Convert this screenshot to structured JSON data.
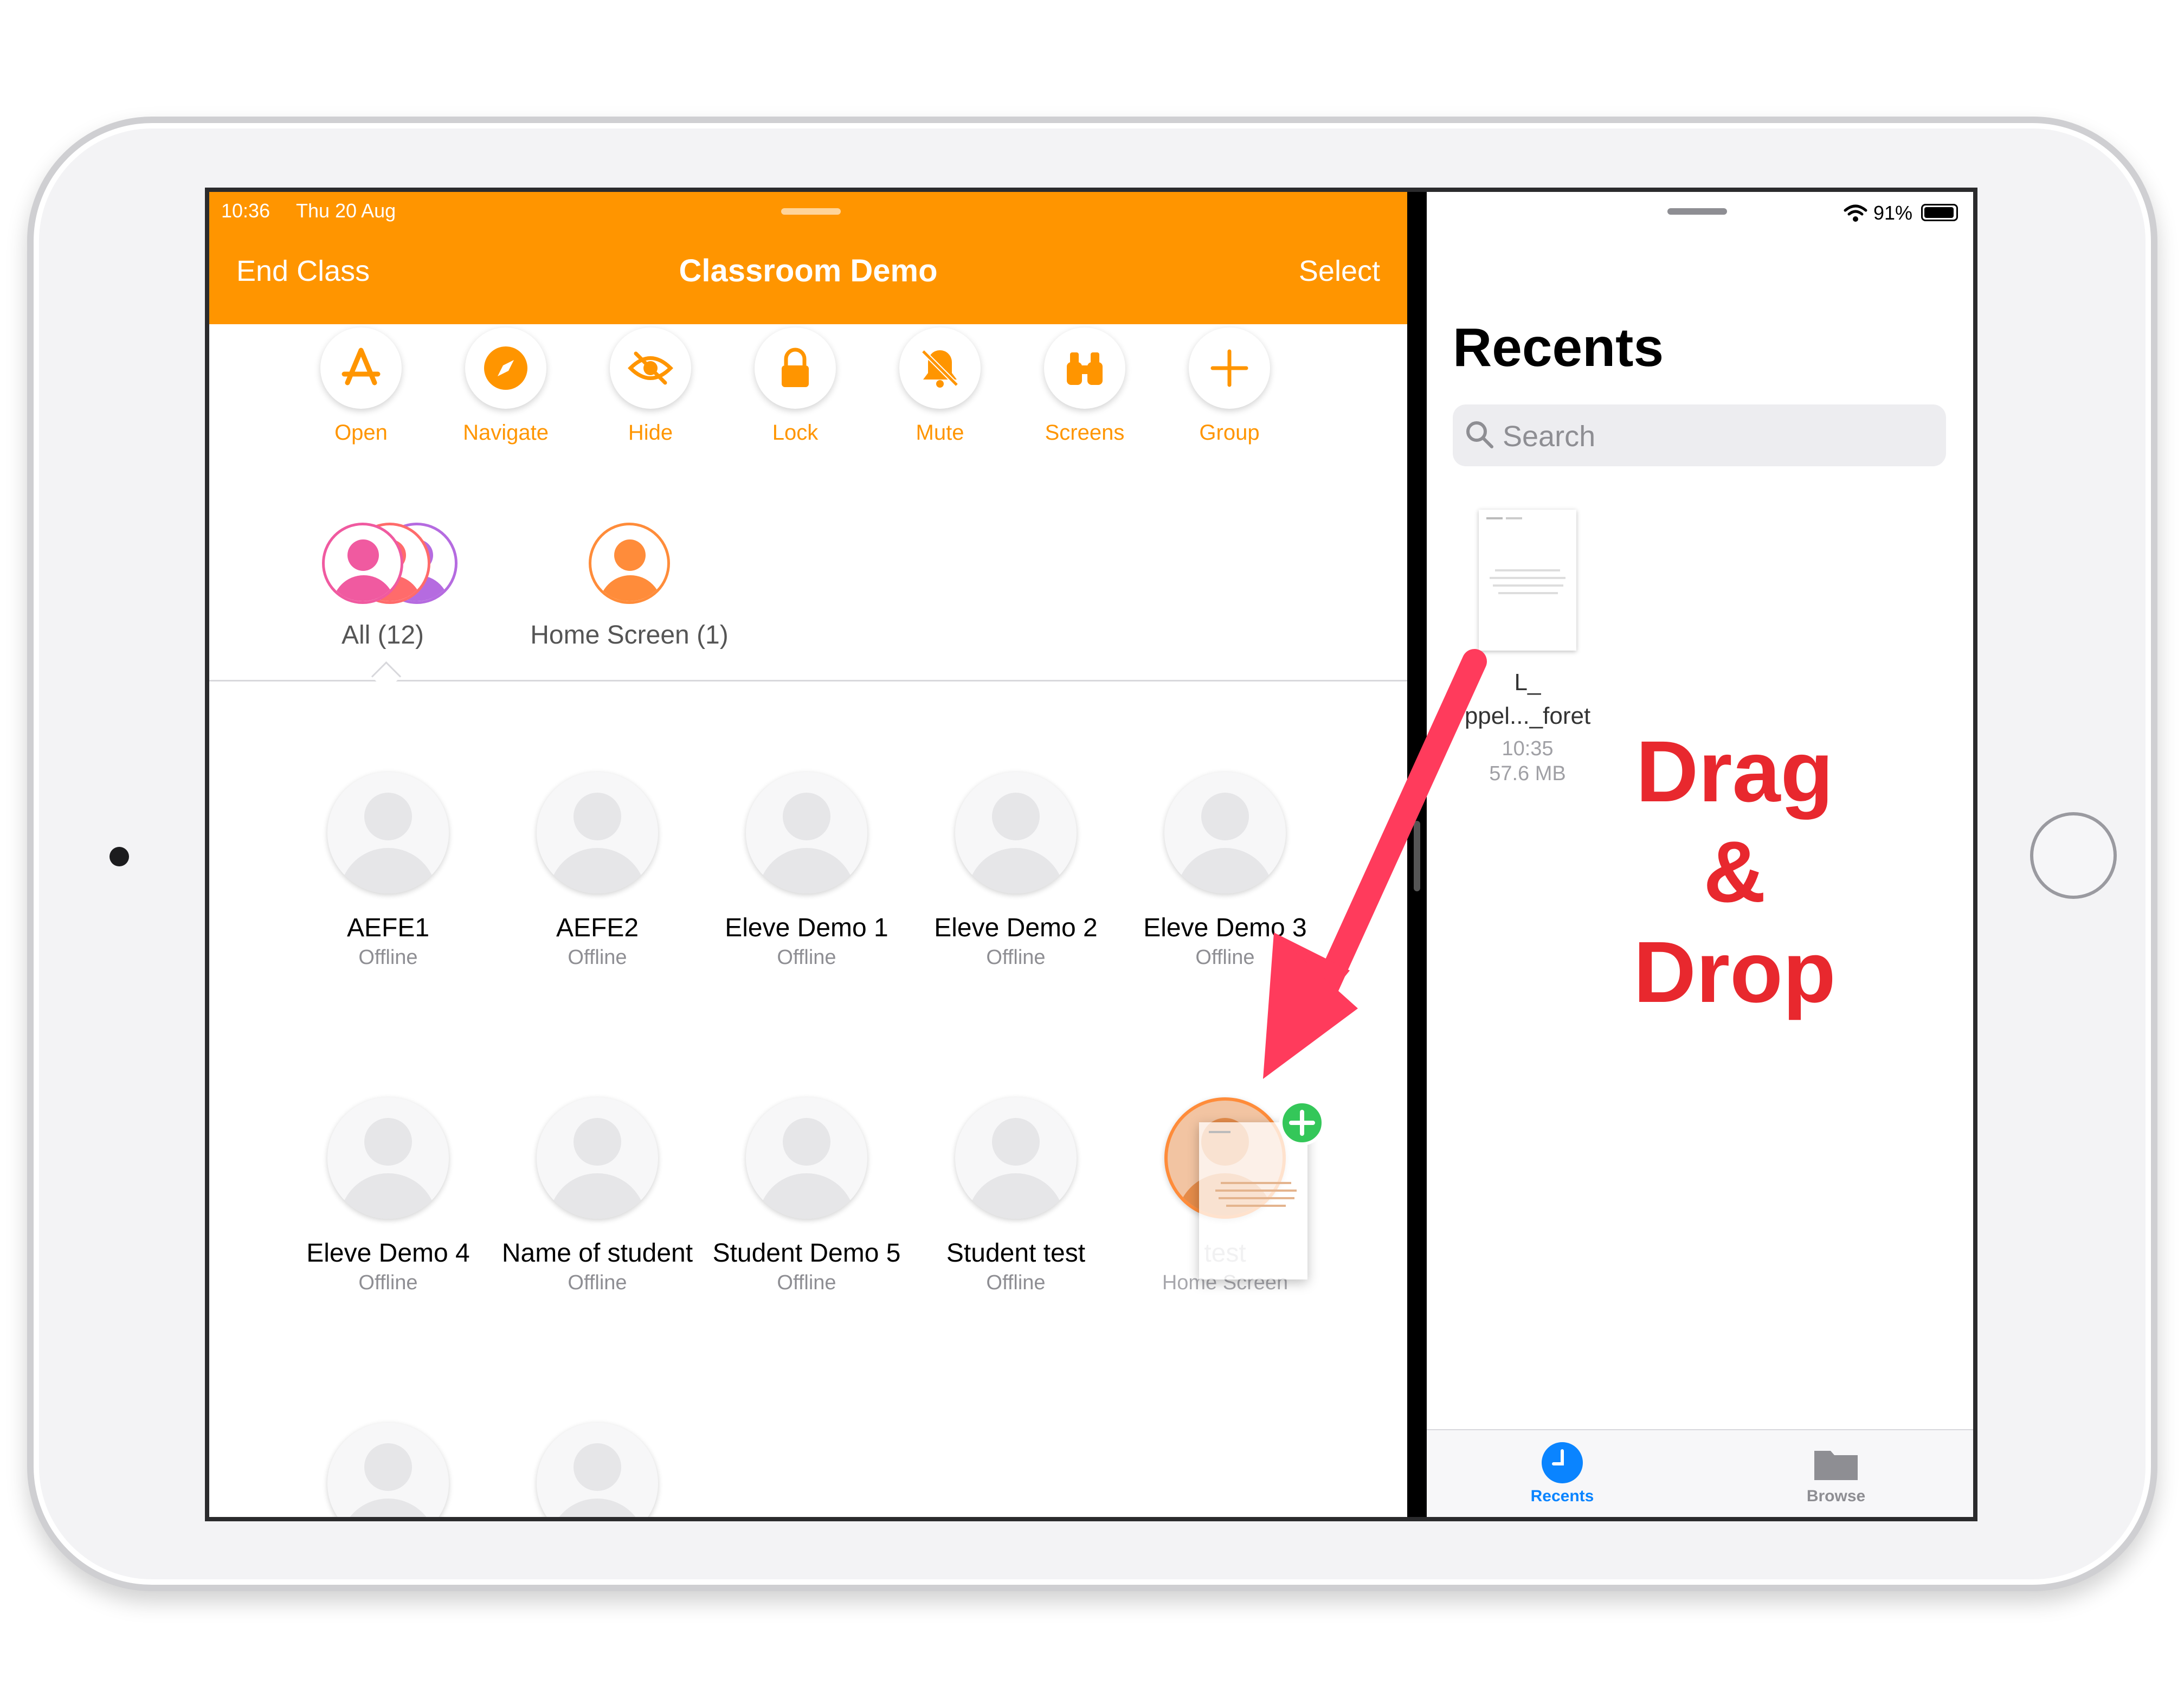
{
  "status_bar": {
    "time": "10:36",
    "date": "Thu 20 Aug",
    "battery": "91%"
  },
  "nav": {
    "left_button": "End Class",
    "title": "Classroom Demo",
    "right_button": "Select"
  },
  "actions": [
    {
      "label": "Open",
      "icon": "app-store-icon"
    },
    {
      "label": "Navigate",
      "icon": "compass-icon"
    },
    {
      "label": "Hide",
      "icon": "eye-slash-icon"
    },
    {
      "label": "Lock",
      "icon": "lock-icon"
    },
    {
      "label": "Mute",
      "icon": "bell-slash-icon"
    },
    {
      "label": "Screens",
      "icon": "binoculars-icon"
    },
    {
      "label": "Group",
      "icon": "plus-icon"
    }
  ],
  "groups": [
    {
      "label": "All (12)",
      "selected": true
    },
    {
      "label": "Home Screen (1)",
      "selected": false
    }
  ],
  "students": [
    {
      "name": "AEFE1",
      "status": "Offline"
    },
    {
      "name": "AEFE2",
      "status": "Offline"
    },
    {
      "name": "Eleve Demo 1",
      "status": "Offline"
    },
    {
      "name": "Eleve Demo 2",
      "status": "Offline"
    },
    {
      "name": "Eleve Demo 3",
      "status": "Offline"
    },
    {
      "name": "Eleve Demo 4",
      "status": "Offline"
    },
    {
      "name": "Name of student",
      "status": "Offline"
    },
    {
      "name": "Student Demo 5",
      "status": "Offline"
    },
    {
      "name": "Student test",
      "status": "Offline"
    },
    {
      "name": "test",
      "status": "Home Screen"
    }
  ],
  "files_app": {
    "title": "Recents",
    "search_placeholder": "Search",
    "file": {
      "name_line1": "L_",
      "name_line2": "ppel..._foret",
      "time": "10:35",
      "size": "57.6 MB"
    },
    "tabs": [
      {
        "label": "Recents",
        "active": true
      },
      {
        "label": "Browse",
        "active": false
      }
    ]
  },
  "annotation": {
    "line1": "Drag",
    "line2": "&",
    "line3": "Drop"
  },
  "colors": {
    "accent": "#ff9500",
    "files_blue": "#0a84ff",
    "annotation_red": "#e8282e",
    "drag_add_green": "#34c759"
  }
}
